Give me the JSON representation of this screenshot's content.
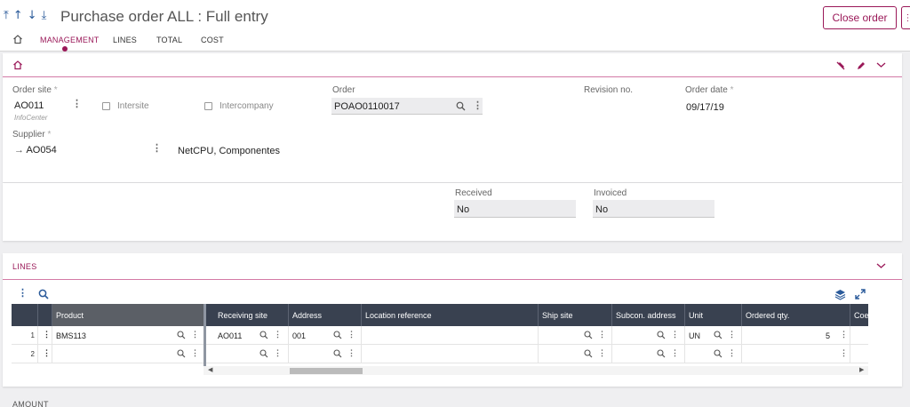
{
  "header": {
    "title": "Purchase order ALL : Full entry",
    "close_label": "Close order",
    "nav_arrows": [
      "⤒",
      "↑",
      "↓",
      "⤓"
    ]
  },
  "tabs": [
    {
      "label": "MANAGEMENT",
      "active": true
    },
    {
      "label": "LINES",
      "active": false
    },
    {
      "label": "TOTAL",
      "active": false
    },
    {
      "label": "COST",
      "active": false
    }
  ],
  "management": {
    "order_site_label": "Order site",
    "order_site_value": "AO011",
    "order_site_sub": "InfoCenter",
    "intersite_label": "Intersite",
    "intercompany_label": "Intercompany",
    "order_label": "Order",
    "order_value": "POAO0110017",
    "revision_label": "Revision no.",
    "order_date_label": "Order date",
    "order_date_value": "09/17/19",
    "supplier_label": "Supplier",
    "supplier_value": "AO054",
    "supplier_name": "NetCPU, Componentes",
    "required_mark": "*"
  },
  "status": {
    "received_label": "Received",
    "received_value": "No",
    "invoiced_label": "Invoiced",
    "invoiced_value": "No"
  },
  "lines": {
    "section_title": "LINES",
    "columns": [
      "Product",
      "Receiving site",
      "Address",
      "Location reference",
      "Ship site",
      "Subcon. address",
      "Unit",
      "Ordered qty.",
      "Coef"
    ],
    "rows": [
      {
        "num": "1",
        "product": "BMS113",
        "receiving_site": "AO011",
        "address": "001",
        "location_reference": "",
        "ship_site": "",
        "subcon_address": "",
        "unit": "UN",
        "ordered_qty": "5"
      },
      {
        "num": "2",
        "product": "",
        "receiving_site": "",
        "address": "",
        "location_reference": "",
        "ship_site": "",
        "subcon_address": "",
        "unit": "",
        "ordered_qty": ""
      }
    ]
  },
  "amount_title": "AMOUNT",
  "colors": {
    "accent": "#9a1858",
    "grid_header": "#394150",
    "nav_blue": "#2a5a9a"
  }
}
